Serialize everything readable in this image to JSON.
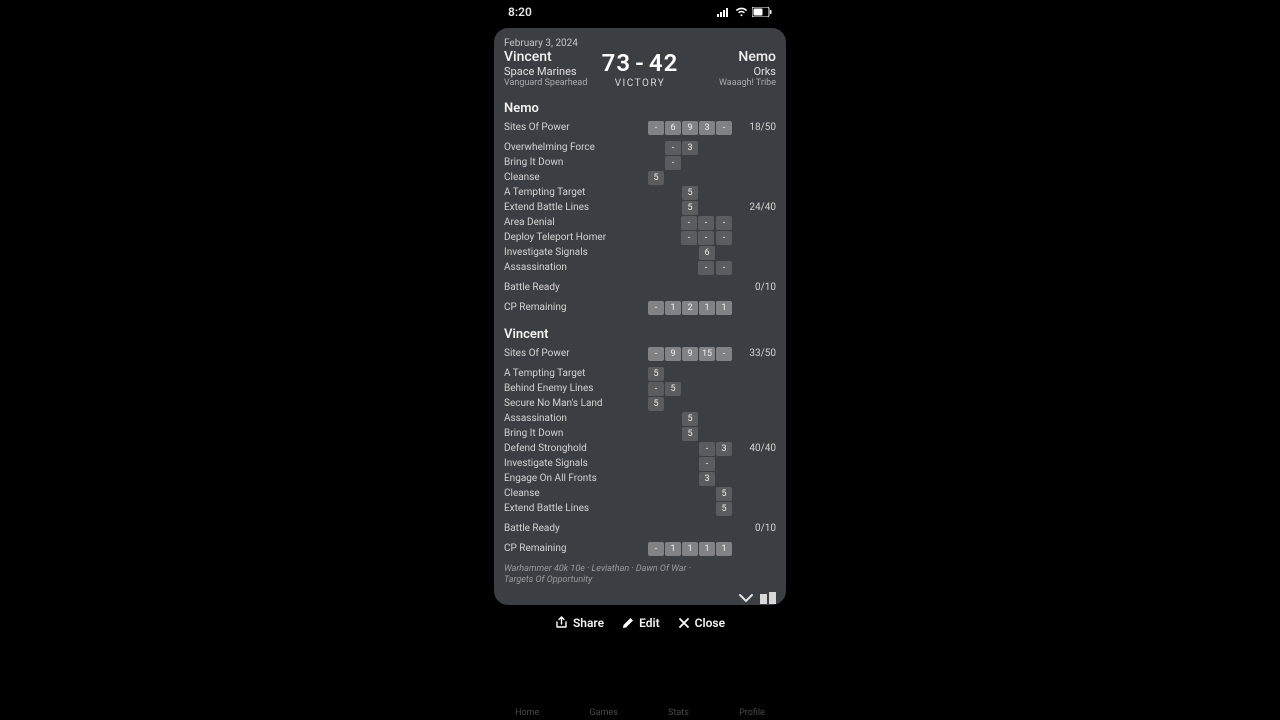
{
  "status": {
    "time": "8:20"
  },
  "match": {
    "date": "February 3, 2024",
    "p1": {
      "name": "Vincent",
      "faction": "Space Marines",
      "detachment": "Vanguard Spearhead",
      "score": "73"
    },
    "p2": {
      "name": "Nemo",
      "faction": "Orks",
      "detachment": "Waaagh! Tribe",
      "score": "42"
    },
    "result": "VICTORY",
    "footnote": "Warhammer 40k 10e · Leviathan · Dawn Of War · Targets Of Opportunity"
  },
  "actions": {
    "share": "Share",
    "edit": "Edit",
    "close": "Close"
  },
  "tabs": {
    "home": "Home",
    "games": "Games",
    "stats": "Stats",
    "profile": "Profile"
  },
  "nemo": {
    "title": "Nemo",
    "primary": {
      "label": "Sites Of Power",
      "cells": [
        "-",
        "6",
        "9",
        "3",
        "-"
      ],
      "total": "18/50"
    },
    "secondaries_total": "24/40",
    "secondaries": [
      {
        "label": "Overwhelming Force",
        "cells": [
          "",
          "-",
          "3",
          "",
          ""
        ]
      },
      {
        "label": "Bring It Down",
        "cells": [
          "",
          "-",
          "",
          "",
          ""
        ]
      },
      {
        "label": "Cleanse",
        "cells": [
          "5",
          "",
          "",
          "",
          ""
        ]
      },
      {
        "label": "A Tempting Target",
        "cells": [
          "",
          "",
          "5",
          "",
          ""
        ]
      },
      {
        "label": "Extend Battle Lines",
        "cells": [
          "",
          "",
          "5",
          "",
          ""
        ]
      },
      {
        "label": "Area Denial",
        "cells": [
          "",
          "",
          "",
          "-",
          "-"
        ],
        "extra": "-"
      },
      {
        "label": "Deploy Teleport Homer",
        "cells": [
          "",
          "",
          "",
          "-",
          "-"
        ],
        "extra": "-"
      },
      {
        "label": "Investigate Signals",
        "cells": [
          "",
          "",
          "",
          "6",
          ""
        ]
      },
      {
        "label": "Assassination",
        "cells": [
          "",
          "",
          "",
          "",
          "-"
        ],
        "extra": "-"
      }
    ],
    "battle_ready": {
      "label": "Battle Ready",
      "total": "0/10"
    },
    "cp": {
      "label": "CP Remaining",
      "cells": [
        "-",
        "1",
        "2",
        "1",
        "1"
      ]
    }
  },
  "vincent": {
    "title": "Vincent",
    "primary": {
      "label": "Sites Of Power",
      "cells": [
        "-",
        "9",
        "9",
        "15",
        "-"
      ],
      "total": "33/50"
    },
    "secondaries_total": "40/40",
    "secondaries": [
      {
        "label": "A Tempting Target",
        "cells": [
          "5",
          "",
          "",
          "",
          ""
        ]
      },
      {
        "label": "Behind Enemy Lines",
        "cells": [
          "-",
          "5",
          "",
          "",
          ""
        ]
      },
      {
        "label": "Secure No Man's Land",
        "cells": [
          "5",
          "",
          "",
          "",
          ""
        ]
      },
      {
        "label": "Assassination",
        "cells": [
          "",
          "",
          "5",
          "",
          ""
        ]
      },
      {
        "label": "Bring It Down",
        "cells": [
          "",
          "",
          "5",
          "",
          ""
        ]
      },
      {
        "label": "Defend Stronghold",
        "cells": [
          "",
          "",
          "",
          "-",
          "3"
        ]
      },
      {
        "label": "Investigate Signals",
        "cells": [
          "",
          "",
          "",
          "-",
          ""
        ]
      },
      {
        "label": "Engage On All Fronts",
        "cells": [
          "",
          "",
          "",
          "3",
          ""
        ]
      },
      {
        "label": "Cleanse",
        "cells": [
          "",
          "",
          "",
          "",
          "5"
        ]
      },
      {
        "label": "Extend Battle Lines",
        "cells": [
          "",
          "",
          "",
          "",
          "5"
        ]
      }
    ],
    "battle_ready": {
      "label": "Battle Ready",
      "total": "0/10"
    },
    "cp": {
      "label": "CP Remaining",
      "cells": [
        "-",
        "1",
        "1",
        "1",
        "1"
      ]
    }
  }
}
